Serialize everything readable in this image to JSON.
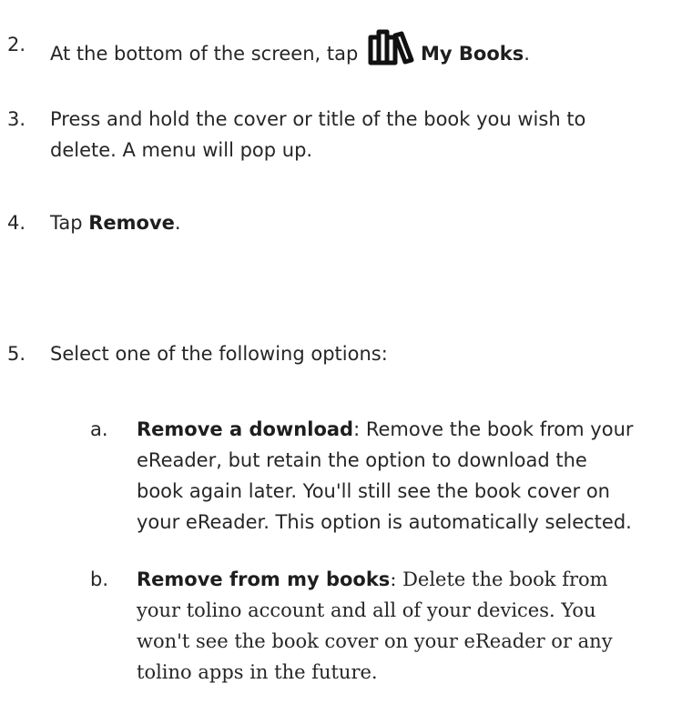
{
  "steps": [
    {
      "number": "2.",
      "before": "At the bottom of the screen, tap",
      "icon": "books-icon",
      "bold": "My Books",
      "after": "."
    },
    {
      "number": "3.",
      "line1": "Press and hold the cover or title of the book you wish to",
      "line2": "delete. A menu will pop up."
    },
    {
      "number": "4.",
      "before": "Tap ",
      "bold": "Remove",
      "after": "."
    },
    {
      "number": "5.",
      "text": "Select one of the following options:"
    }
  ],
  "options": [
    {
      "letter": "a.",
      "bold": "Remove a download",
      "line1": ": Remove the book from your",
      "line2": "eReader, but retain the option to download the",
      "line3": "book again later. You'll still see the book cover on",
      "line4": "your eReader. This option is automatically selected."
    },
    {
      "letter": "b.",
      "bold": "Remove from my books",
      "line1": ": Delete the book from",
      "line2": "your tolino account and all of your devices. You",
      "line3": "won't see the book cover on your eReader or any",
      "line4": "tolino apps in the future."
    }
  ]
}
